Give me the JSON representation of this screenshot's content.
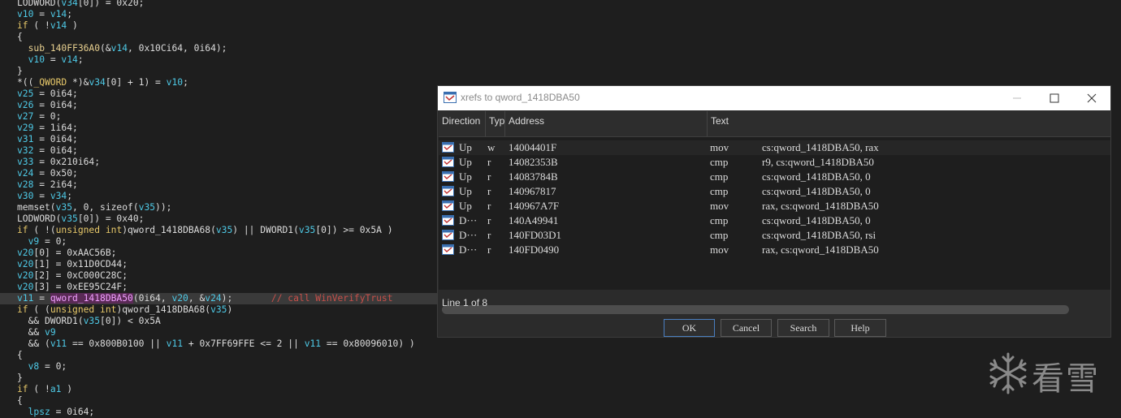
{
  "code_lines": [
    [
      [
        "pl",
        "LODWORD("
      ],
      [
        "var",
        "v34"
      ],
      [
        "pl",
        "[0]) = 0x20;"
      ]
    ],
    [
      [
        "var",
        "v10"
      ],
      [
        "pl",
        " = "
      ],
      [
        "var",
        "v14"
      ],
      [
        "pl",
        ";"
      ]
    ],
    [
      [
        "kw",
        "if"
      ],
      [
        "pl",
        " ( !"
      ],
      [
        "var",
        "v14"
      ],
      [
        "pl",
        " )"
      ]
    ],
    [
      [
        "pl",
        "{"
      ]
    ],
    [
      [
        "pl",
        "  "
      ],
      [
        "fn",
        "sub_140FF36A0"
      ],
      [
        "pl",
        "(&"
      ],
      [
        "var",
        "v14"
      ],
      [
        "pl",
        ", 0x10Ci64, 0i64);"
      ]
    ],
    [
      [
        "pl",
        "  "
      ],
      [
        "var",
        "v10"
      ],
      [
        "pl",
        " = "
      ],
      [
        "var",
        "v14"
      ],
      [
        "pl",
        ";"
      ]
    ],
    [
      [
        "pl",
        "}"
      ]
    ],
    [
      [
        "pl",
        "*(("
      ],
      [
        "typ",
        "_QWORD"
      ],
      [
        "pl",
        " *)&"
      ],
      [
        "var",
        "v34"
      ],
      [
        "pl",
        "[0] + 1) = "
      ],
      [
        "var",
        "v10"
      ],
      [
        "pl",
        ";"
      ]
    ],
    [
      [
        "var",
        "v25"
      ],
      [
        "pl",
        " = 0i64;"
      ]
    ],
    [
      [
        "var",
        "v26"
      ],
      [
        "pl",
        " = 0i64;"
      ]
    ],
    [
      [
        "var",
        "v27"
      ],
      [
        "pl",
        " = 0;"
      ]
    ],
    [
      [
        "var",
        "v29"
      ],
      [
        "pl",
        " = 1i64;"
      ]
    ],
    [
      [
        "var",
        "v31"
      ],
      [
        "pl",
        " = 0i64;"
      ]
    ],
    [
      [
        "var",
        "v32"
      ],
      [
        "pl",
        " = 0i64;"
      ]
    ],
    [
      [
        "var",
        "v33"
      ],
      [
        "pl",
        " = 0x210i64;"
      ]
    ],
    [
      [
        "var",
        "v24"
      ],
      [
        "pl",
        " = 0x50;"
      ]
    ],
    [
      [
        "var",
        "v28"
      ],
      [
        "pl",
        " = 2i64;"
      ]
    ],
    [
      [
        "var",
        "v30"
      ],
      [
        "pl",
        " = "
      ],
      [
        "var",
        "v34"
      ],
      [
        "pl",
        ";"
      ]
    ],
    [
      [
        "pl",
        "memset("
      ],
      [
        "var",
        "v35"
      ],
      [
        "pl",
        ", 0, sizeof("
      ],
      [
        "var",
        "v35"
      ],
      [
        "pl",
        "));"
      ]
    ],
    [
      [
        "pl",
        "LODWORD("
      ],
      [
        "var",
        "v35"
      ],
      [
        "pl",
        "[0]) = 0x40;"
      ]
    ],
    [
      [
        "kw",
        "if"
      ],
      [
        "pl",
        " ( !("
      ],
      [
        "kw",
        "unsigned int"
      ],
      [
        "pl",
        ")qword_1418DBA68("
      ],
      [
        "var",
        "v35"
      ],
      [
        "pl",
        ") || DWORD1("
      ],
      [
        "var",
        "v35"
      ],
      [
        "pl",
        "[0]) >= 0x5A )"
      ]
    ],
    [
      [
        "pl",
        "  "
      ],
      [
        "var",
        "v9"
      ],
      [
        "pl",
        " = 0;"
      ]
    ],
    [
      [
        "var",
        "v20"
      ],
      [
        "pl",
        "[0] = 0xAAC56B;"
      ]
    ],
    [
      [
        "var",
        "v20"
      ],
      [
        "pl",
        "[1] = 0x11D0CD44;"
      ]
    ],
    [
      [
        "var",
        "v20"
      ],
      [
        "pl",
        "[2] = 0xC000C28C;"
      ]
    ],
    [
      [
        "var",
        "v20"
      ],
      [
        "pl",
        "[3] = 0xEE95C24F;"
      ]
    ],
    [
      [
        "var",
        "v11"
      ],
      [
        "pl",
        " = "
      ],
      [
        "sel",
        "qword_1418DBA50"
      ],
      [
        "pl",
        "(0i64, "
      ],
      [
        "var",
        "v20"
      ],
      [
        "pl",
        ", &"
      ],
      [
        "var",
        "v24"
      ],
      [
        "pl",
        ");       "
      ],
      [
        "cmt",
        "// call WinVerifyTrust"
      ]
    ],
    [
      [
        "kw",
        "if"
      ],
      [
        "pl",
        " ( ("
      ],
      [
        "kw",
        "unsigned int"
      ],
      [
        "pl",
        ")qword_1418DBA68("
      ],
      [
        "var",
        "v35"
      ],
      [
        "pl",
        ")"
      ]
    ],
    [
      [
        "pl",
        "  && DWORD1("
      ],
      [
        "var",
        "v35"
      ],
      [
        "pl",
        "[0]) < 0x5A"
      ]
    ],
    [
      [
        "pl",
        "  && "
      ],
      [
        "var",
        "v9"
      ]
    ],
    [
      [
        "pl",
        "  && ("
      ],
      [
        "var",
        "v11"
      ],
      [
        "pl",
        " == 0x800B0100 || "
      ],
      [
        "var",
        "v11"
      ],
      [
        "pl",
        " + 0x7FF69FFE <= 2 || "
      ],
      [
        "var",
        "v11"
      ],
      [
        "pl",
        " == 0x80096010) )"
      ]
    ],
    [
      [
        "pl",
        "{"
      ]
    ],
    [
      [
        "pl",
        "  "
      ],
      [
        "var",
        "v8"
      ],
      [
        "pl",
        " = 0;"
      ]
    ],
    [
      [
        "pl",
        "}"
      ]
    ],
    [
      [
        "kw",
        "if"
      ],
      [
        "pl",
        " ( !"
      ],
      [
        "var",
        "a1"
      ],
      [
        "pl",
        " )"
      ]
    ],
    [
      [
        "pl",
        "{"
      ]
    ],
    [
      [
        "pl",
        "  "
      ],
      [
        "var",
        "lpsz"
      ],
      [
        "pl",
        " = 0i64;"
      ]
    ]
  ],
  "highlight_line": 26,
  "dialog": {
    "title": "xrefs to qword_1418DBA50",
    "columns": {
      "direction": "Direction",
      "type": "Typ",
      "address": "Address",
      "text": "Text"
    },
    "rows": [
      {
        "direction": "Up",
        "type": "w",
        "address": "14004401F",
        "mnemonic": "mov",
        "operands": "cs:qword_1418DBA50, rax"
      },
      {
        "direction": "Up",
        "type": "r",
        "address": "14082353B",
        "mnemonic": "cmp",
        "operands": "r9, cs:qword_1418DBA50"
      },
      {
        "direction": "Up",
        "type": "r",
        "address": "14083784B",
        "mnemonic": "cmp",
        "operands": "cs:qword_1418DBA50, 0"
      },
      {
        "direction": "Up",
        "type": "r",
        "address": "140967817",
        "mnemonic": "cmp",
        "operands": "cs:qword_1418DBA50, 0"
      },
      {
        "direction": "Up",
        "type": "r",
        "address": "140967A7F",
        "mnemonic": "mov",
        "operands": "rax, cs:qword_1418DBA50"
      },
      {
        "direction": "D···",
        "type": "r",
        "address": "140A49941",
        "mnemonic": "cmp",
        "operands": "cs:qword_1418DBA50, 0"
      },
      {
        "direction": "D···",
        "type": "r",
        "address": "140FD03D1",
        "mnemonic": "cmp",
        "operands": "cs:qword_1418DBA50, rsi"
      },
      {
        "direction": "D···",
        "type": "r",
        "address": "140FD0490",
        "mnemonic": "mov",
        "operands": "rax, cs:qword_1418DBA50"
      }
    ],
    "status": "Line 1 of 8",
    "buttons": {
      "ok": "OK",
      "cancel": "Cancel",
      "search": "Search",
      "help": "Help"
    }
  },
  "watermark_text": "看雪",
  "colors": {
    "background": "#1e1e1e",
    "variable": "#4ec9e6",
    "keyword": "#e8c96a",
    "comment": "#c8504a",
    "selected_symbol": "#f0a0ff"
  },
  "icons": {
    "row_icon": "xref-icon",
    "title_icon": "ida-window-icon",
    "watermark_icon": "snowflake-icon"
  }
}
